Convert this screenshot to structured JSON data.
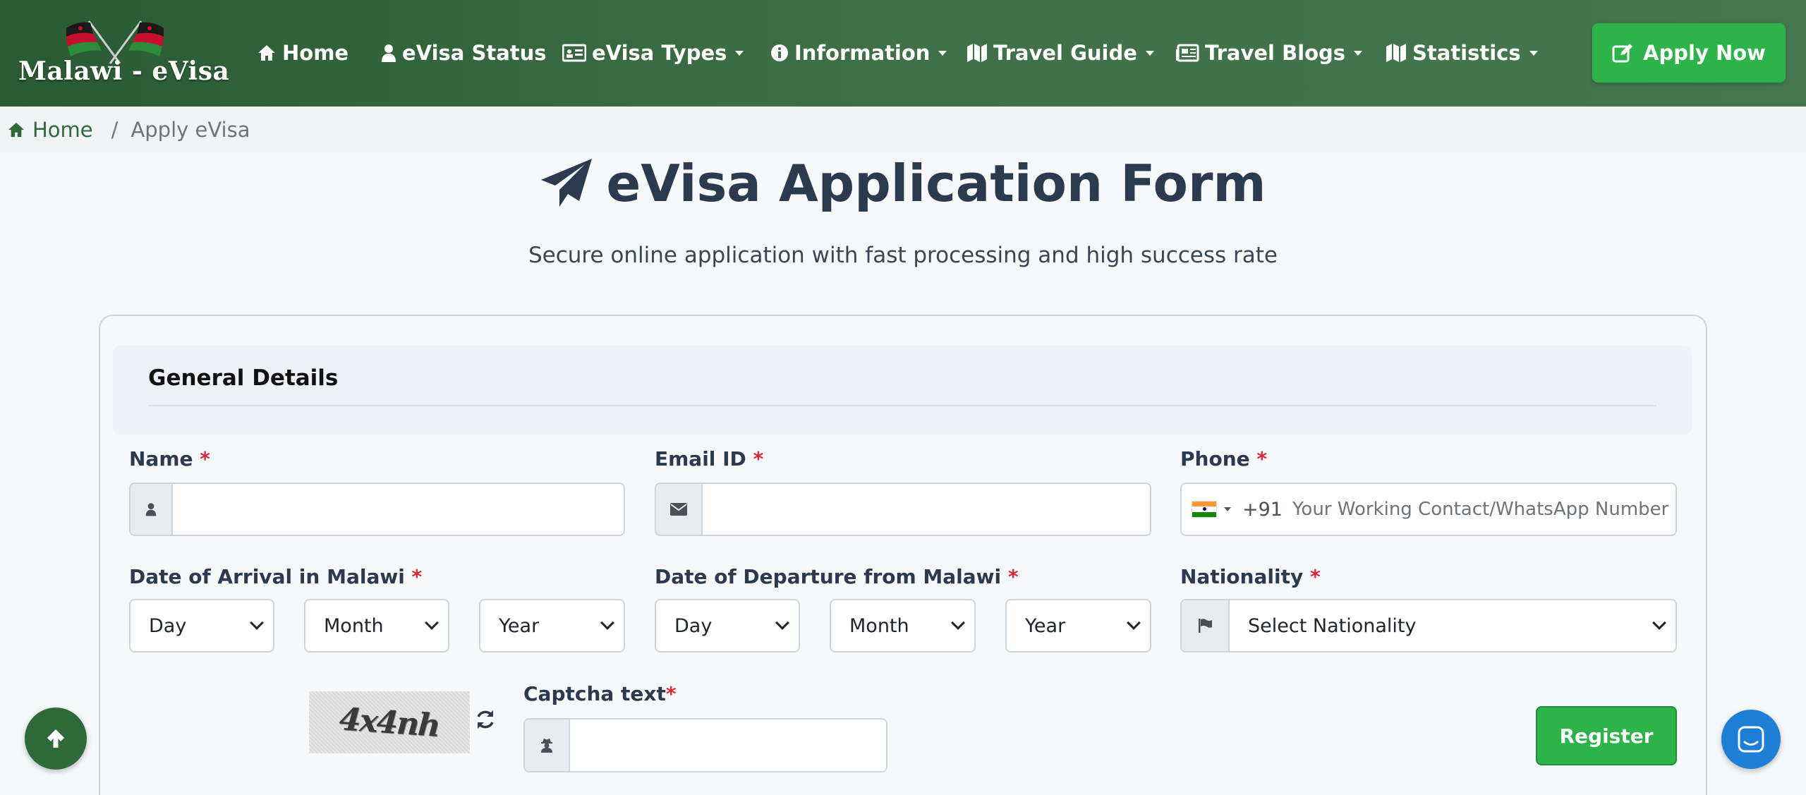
{
  "brand": {
    "logo_text": "Malawi - eVisa"
  },
  "nav": {
    "home": "Home",
    "status": "eVisa Status",
    "types": "eVisa Types",
    "information": "Information",
    "travel_guide": "Travel Guide",
    "travel_blogs": "Travel Blogs",
    "statistics": "Statistics",
    "apply": "Apply Now"
  },
  "breadcrumb": {
    "home": "Home",
    "separator": "/",
    "current": "Apply eVisa"
  },
  "page": {
    "title": "eVisa Application Form",
    "subtitle": "Secure online application with fast processing and high success rate"
  },
  "form": {
    "section_title": "General Details",
    "required_mark": "*",
    "name_label": "Name",
    "email_label": "Email ID",
    "phone_label": "Phone",
    "phone_dial_code": "+91",
    "phone_placeholder": "Your Working Contact/WhatsApp Number",
    "arrival_label": "Date of Arrival in Malawi",
    "departure_label": "Date of Departure from Malawi",
    "nationality_label": "Nationality",
    "day": "Day",
    "month": "Month",
    "year": "Year",
    "nationality_placeholder": "Select Nationality",
    "captcha_image_text": "4x4nh",
    "captcha_label": "Captcha text",
    "register": "Register"
  },
  "colors": {
    "nav_green": "#2a5a33",
    "accent_green": "#2cb34a",
    "required_red": "#d6283a",
    "chat_blue": "#1f7ed6"
  },
  "icons": [
    "home-icon",
    "user-icon",
    "id-card-icon",
    "info-icon",
    "map-icon",
    "newspaper-icon",
    "edit-icon",
    "paper-plane-icon",
    "envelope-icon",
    "flag-icon",
    "user-secret-icon",
    "refresh-icon",
    "arrow-up-icon",
    "chat-icon"
  ]
}
